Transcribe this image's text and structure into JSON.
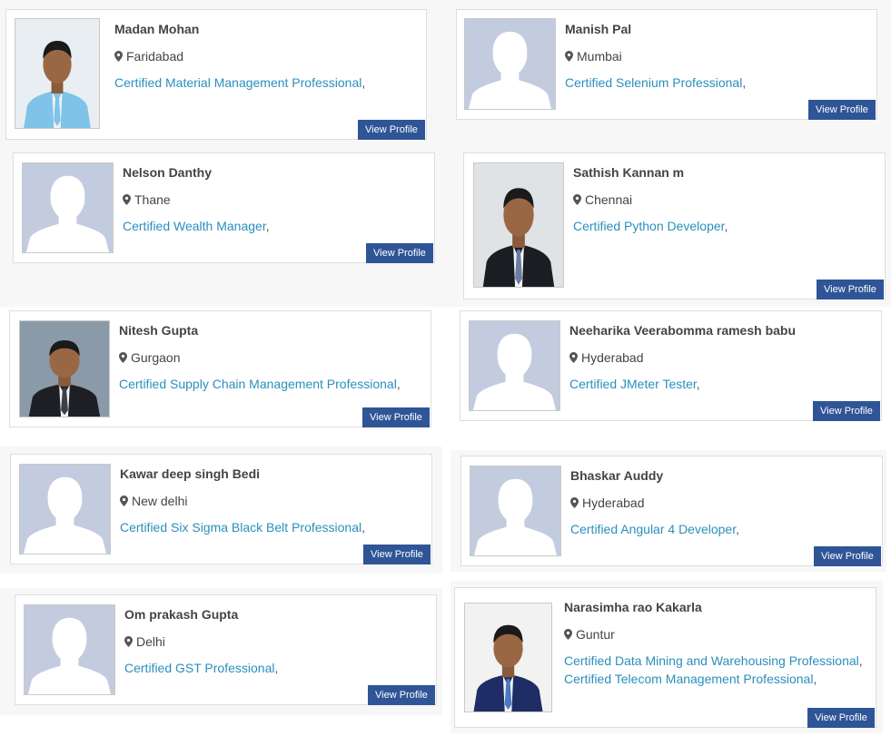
{
  "profiles": [
    {
      "name": "Madan Mohan",
      "location": "Faridabad",
      "certs": [
        "Certified Material Management Professional"
      ],
      "button": "View Profile",
      "photo": "photo-man-light-shirt"
    },
    {
      "name": "Manish Pal",
      "location": "Mumbai",
      "certs": [
        "Certified Selenium Professional"
      ],
      "button": "View Profile",
      "photo": "placeholder-avatar"
    },
    {
      "name": "Nelson Danthy",
      "location": "Thane",
      "certs": [
        "Certified Wealth Manager"
      ],
      "button": "View Profile",
      "photo": "placeholder-avatar"
    },
    {
      "name": "Sathish Kannan m",
      "location": "Chennai",
      "certs": [
        "Certified Python Developer"
      ],
      "button": "View Profile",
      "photo": "photo-man-suit-tie"
    },
    {
      "name": "Nitesh Gupta",
      "location": "Gurgaon",
      "certs": [
        "Certified Supply Chain Management Professional"
      ],
      "button": "View Profile",
      "photo": "photo-man-suit-outdoor"
    },
    {
      "name": "Neeharika Veerabomma ramesh babu",
      "location": "Hyderabad",
      "certs": [
        "Certified JMeter Tester"
      ],
      "button": "View Profile",
      "photo": "placeholder-avatar"
    },
    {
      "name": "Kawar deep singh Bedi",
      "location": "New delhi",
      "certs": [
        "Certified Six Sigma Black Belt Professional"
      ],
      "button": "View Profile",
      "photo": "placeholder-avatar"
    },
    {
      "name": "Bhaskar Auddy",
      "location": "Hyderabad",
      "certs": [
        "Certified Angular 4 Developer"
      ],
      "button": "View Profile",
      "photo": "placeholder-avatar"
    },
    {
      "name": "Om prakash Gupta",
      "location": "Delhi",
      "certs": [
        "Certified GST Professional"
      ],
      "button": "View Profile",
      "photo": "placeholder-avatar"
    },
    {
      "name": "Narasimha rao Kakarla",
      "location": "Guntur",
      "certs": [
        "Certified Data Mining and Warehousing Professional",
        "Certified Telecom Management Professional"
      ],
      "button": "View Profile",
      "photo": "photo-man-blue-blazer"
    }
  ],
  "separator": ",",
  "icons": {
    "location": "map-marker-icon"
  },
  "colors": {
    "link": "#2a8fbd",
    "button": "#2f5597",
    "placeholder": "#c3cbdf",
    "name": "#444444"
  }
}
